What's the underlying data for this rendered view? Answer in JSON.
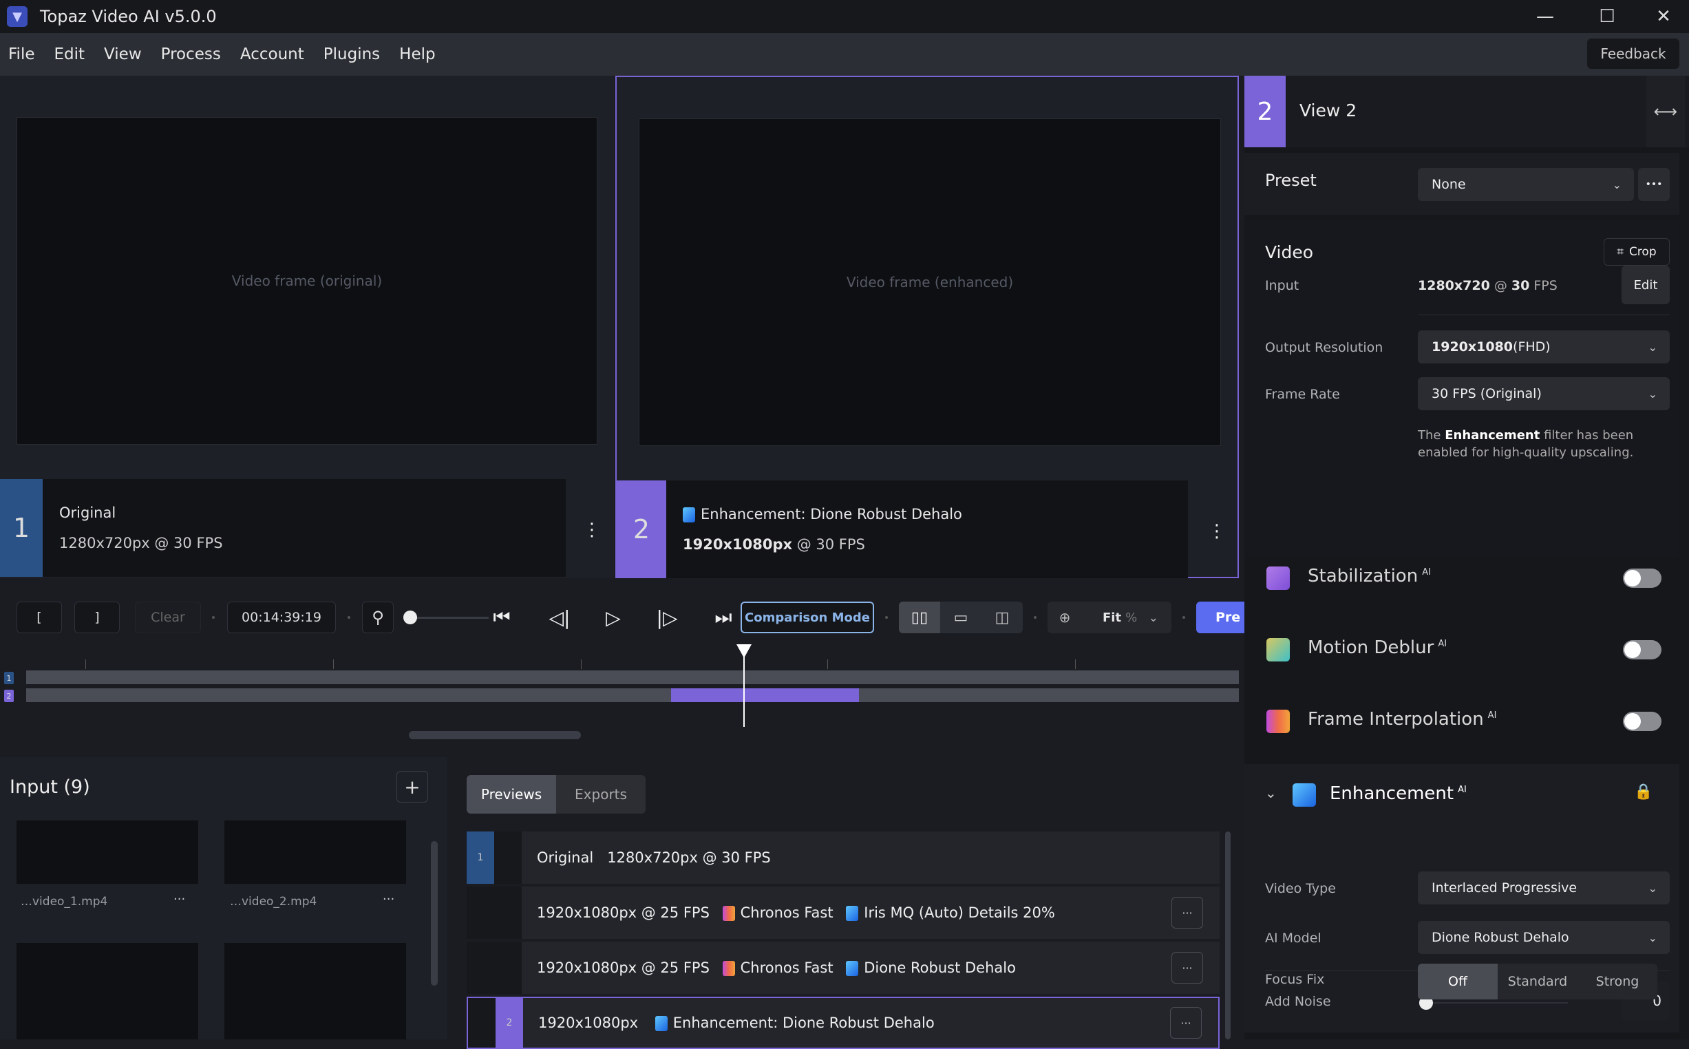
{
  "window": {
    "title": "Topaz Video AI  v5.0.0",
    "controls": {
      "minimize": "—",
      "maximize": "☐",
      "close": "✕"
    }
  },
  "menu": [
    "File",
    "Edit",
    "View",
    "Process",
    "Account",
    "Plugins",
    "Help"
  ],
  "feedback_label": "Feedback",
  "views": [
    {
      "num": "1",
      "title": "Original",
      "info": "1280x720px @ 30 FPS",
      "frame_placeholder": "Video frame (original)"
    },
    {
      "num": "2",
      "title": "Enhancement: Dione Robust Dehalo",
      "info_bold": "1920x1080px",
      "info_rest": " @ 30 FPS",
      "frame_placeholder": "Video frame (enhanced)"
    }
  ],
  "toolbar": {
    "mark_in": "[",
    "mark_out": "]",
    "clear": "Clear",
    "timecode": "00:14:39:19",
    "comparison_mode": "Comparison Mode",
    "zoom_level": "Fit",
    "zoom_unit": "%",
    "preview_label": "Pre",
    "zoom_slider_value": 0
  },
  "timeline": {
    "tracks": [
      {
        "badge": "1",
        "color": "#2a5286"
      },
      {
        "badge": "2",
        "color": "#7a64d8",
        "segment_start_fraction": 0.532,
        "segment_end_fraction": 0.687
      }
    ],
    "playhead_fraction": 0.592
  },
  "input_panel": {
    "title": "Input (9)",
    "add_label": "+",
    "items": [
      {
        "name": "…video_1.mp4"
      },
      {
        "name": "…video_2.mp4"
      }
    ]
  },
  "preview_panel": {
    "tabs": [
      "Previews",
      "Exports"
    ],
    "active_tab": 0,
    "rows": [
      {
        "badge": "1",
        "text_bold": "Original",
        "text": "1280x720px @ 30 FPS"
      },
      {
        "badge": "",
        "text": "1920x1080px @ 25 FPS",
        "fx1": "Chronos Fast",
        "fx2": "Iris MQ (Auto) Details 20%"
      },
      {
        "badge": "",
        "text": "1920x1080px @ 25 FPS",
        "fx1": "Chronos Fast",
        "fx2": "Dione Robust Dehalo"
      },
      {
        "badge": "2",
        "text": "1920x1080px",
        "fx2": "Enhancement: Dione Robust Dehalo"
      }
    ],
    "row_more": "···"
  },
  "right_panel": {
    "view_num": "2",
    "view_title": "View 2",
    "preset_label": "Preset",
    "preset_value": "None",
    "preset_more": "•••",
    "video_heading": "Video",
    "crop_label": "Crop",
    "input_label": "Input",
    "input_value_bold": "1280x720",
    "input_value_mid": " @ ",
    "input_value_bold2": "30",
    "input_value_rest": " FPS",
    "edit_label": "Edit",
    "output_res_label": "Output Resolution",
    "output_res_bold": "1920x1080",
    "output_res_rest": " (FHD)",
    "frame_rate_label": "Frame Rate",
    "frame_rate_value": "30 FPS (Original)",
    "note_pre": "The ",
    "note_bold": "Enhancement",
    "note_post": " filter has been enabled for high-quality upscaling.",
    "filters": [
      {
        "name": "Stabilization",
        "tag": "AI",
        "enabled": false
      },
      {
        "name": "Motion Deblur",
        "tag": "AI",
        "enabled": false
      },
      {
        "name": "Frame Interpolation",
        "tag": "AI",
        "enabled": false
      }
    ],
    "enhancement": {
      "name": "Enhancement",
      "tag": "AI",
      "video_type_label": "Video Type",
      "video_type_value": "Interlaced Progressive",
      "ai_model_label": "AI Model",
      "ai_model_value": "Dione Robust Dehalo",
      "add_noise_label": "Add Noise",
      "add_noise_value": "0",
      "focus_fix_label": "Focus Fix",
      "focus_fix_options": [
        "Off",
        "Standard",
        "Strong"
      ],
      "focus_fix_selected": 0
    }
  },
  "colors": {
    "accent_purple": "#7a64d8",
    "accent_blue": "#2a5286",
    "preview_button": "#5b6cf0",
    "comparison_outline": "#8bb4e8"
  }
}
